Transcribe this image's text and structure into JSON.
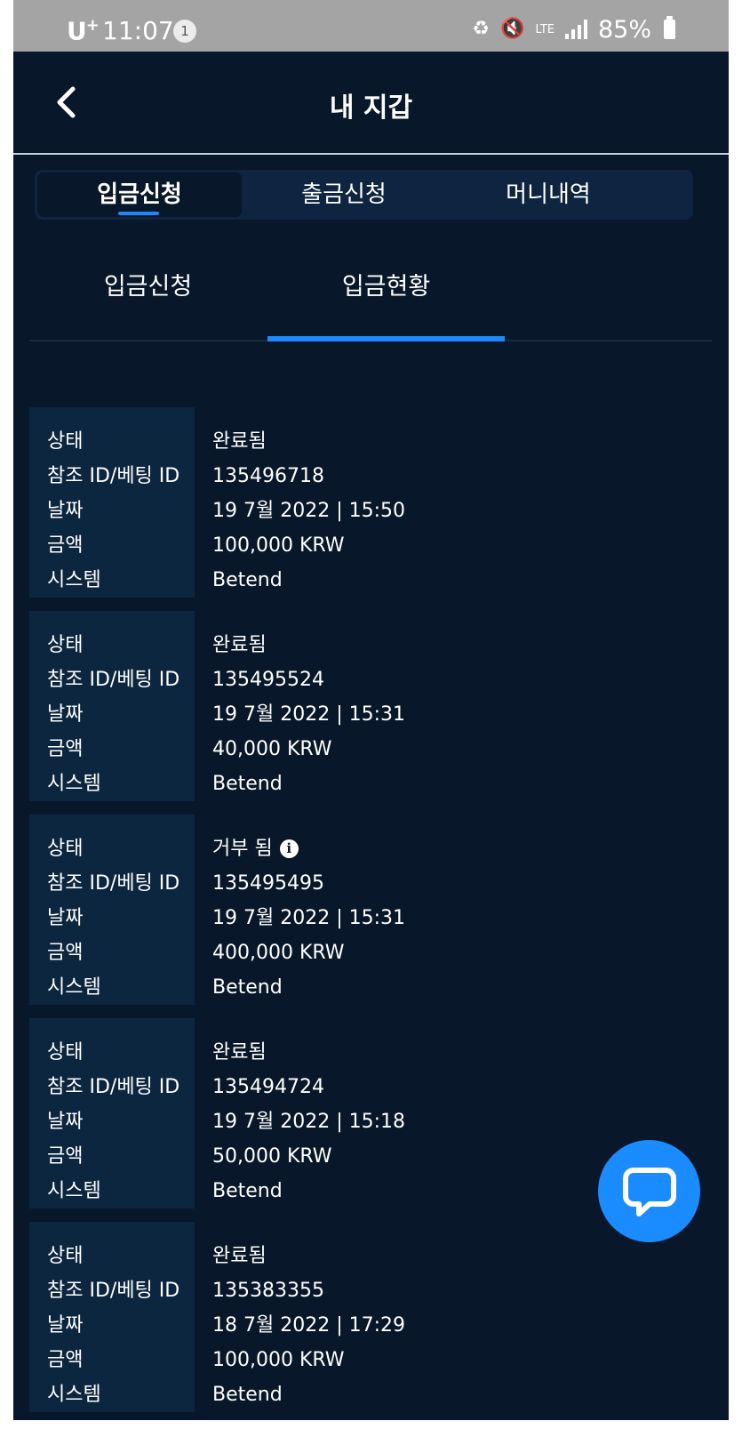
{
  "status_bar": {
    "carrier": "U",
    "carrier_sup": "+",
    "time": "11:07",
    "notification_count": "1",
    "network": "LTE",
    "battery": "85%"
  },
  "header": {
    "title": "내 지갑",
    "back_icon": "chevron-left-icon"
  },
  "segment_tabs": [
    {
      "label": "입금신청",
      "active": true
    },
    {
      "label": "출금신청",
      "active": false
    },
    {
      "label": "머니내역",
      "active": false
    }
  ],
  "sub_tabs": [
    {
      "label": "입금신청",
      "active": false
    },
    {
      "label": "입금현황",
      "active": true
    }
  ],
  "labels": {
    "status": "상태",
    "reference_id": "참조 ID/베팅 ID",
    "date": "날짜",
    "amount": "금액",
    "system": "시스템"
  },
  "records": [
    {
      "status": "완료됨",
      "reference_id": "135496718",
      "date": "19 7월 2022 | 15:50",
      "amount": "100,000 KRW",
      "system": "Betend"
    },
    {
      "status": "완료됨",
      "reference_id": "135495524",
      "date": "19 7월 2022 | 15:31",
      "amount": "40,000 KRW",
      "system": "Betend"
    },
    {
      "status": "거부 됨",
      "reference_id": "135495495",
      "date": "19 7월 2022 | 15:31",
      "amount": "400,000 KRW",
      "system": "Betend",
      "status_icon": "info-icon"
    },
    {
      "status": "완료됨",
      "reference_id": "135494724",
      "date": "19 7월 2022 | 15:18",
      "amount": "50,000 KRW",
      "system": "Betend"
    },
    {
      "status": "완료됨",
      "reference_id": "135383355",
      "date": "18 7월 2022 | 17:29",
      "amount": "100,000 KRW",
      "system": "Betend"
    }
  ],
  "colors": {
    "background": "#081729",
    "panel": "#0d2640",
    "accent": "#1e88ff",
    "chat_button": "#1a8cff"
  }
}
